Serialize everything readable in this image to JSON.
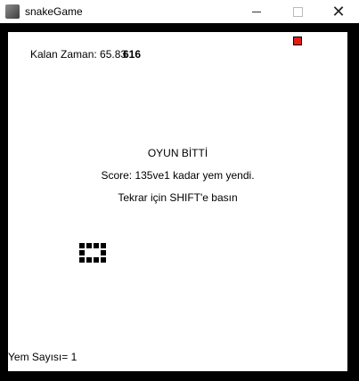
{
  "window": {
    "title": "snakeGame",
    "minimize_label": "—",
    "close_label": "✕"
  },
  "game": {
    "timer_text": "Kalan Zaman: 65.83",
    "timer_overlap_text": "616",
    "game_over_title": "OYUN BİTTİ",
    "score_text": "Score:  135ve1 kadar yem yendi.",
    "restart_text": "Tekrar için SHIFT'e basın",
    "food_count_text": "Yem Sayısı= 1",
    "food_color": "#e21b1b",
    "snake_color": "#000000"
  }
}
